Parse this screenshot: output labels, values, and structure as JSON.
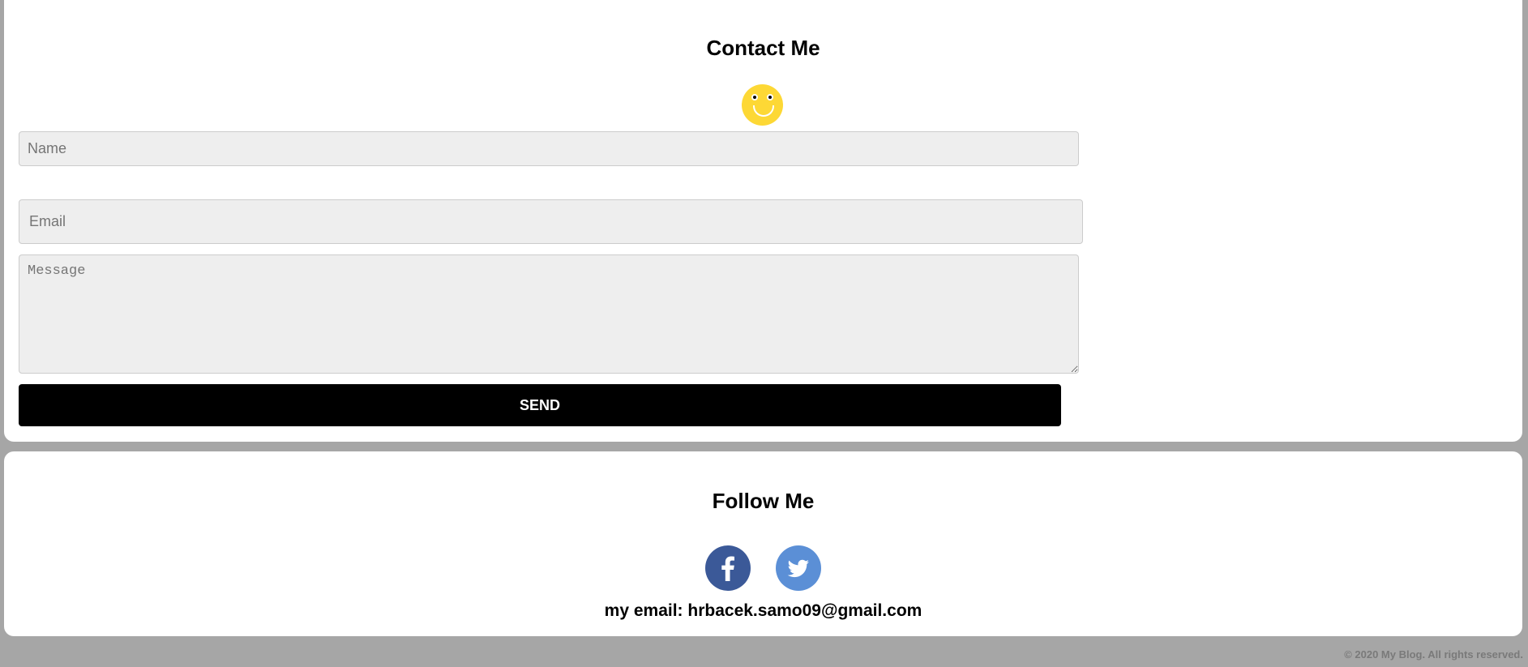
{
  "contact": {
    "title": "Contact Me",
    "name_placeholder": "Name",
    "email_placeholder": "Email",
    "message_placeholder": "Message",
    "send_label": "SEND",
    "smiley_icon": "smiley-face-icon",
    "smiley_color": "#fdd835"
  },
  "follow": {
    "title": "Follow Me",
    "social": [
      {
        "name": "facebook",
        "icon": "facebook-icon",
        "color": "#3b5998"
      },
      {
        "name": "twitter",
        "icon": "twitter-icon",
        "color": "#5b8fd6"
      }
    ],
    "email_text": "my email: hrbacek.samo09@gmail.com"
  },
  "footer": {
    "text": "© 2020 My Blog. All rights reserved."
  },
  "colors": {
    "background": "#a6a6a6",
    "card": "#ffffff",
    "button": "#000000",
    "input_bg": "#eeeeee"
  }
}
